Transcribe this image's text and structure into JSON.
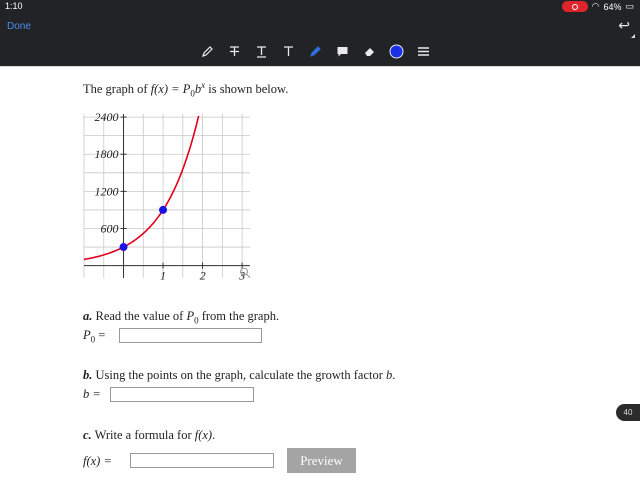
{
  "status_bar": {
    "time": "1:10",
    "battery": "64%"
  },
  "nav": {
    "done_label": "Done"
  },
  "toolbar": {
    "tools": [
      "pen-icon",
      "text-strike-icon",
      "text-underline-icon",
      "text-icon",
      "highlighter-icon",
      "comment-icon",
      "eraser-icon",
      "color-circle-icon",
      "menu-icon"
    ],
    "color": "#1c2fe8"
  },
  "problem": {
    "intro_prefix": "The graph of ",
    "intro_fx": "f(x) = P",
    "intro_sub": "0",
    "intro_b": "b",
    "intro_sup": "x",
    "intro_suffix": " is shown below.",
    "part_a_letter": "a.",
    "part_a_text": " Read the value of ",
    "part_a_var": "P",
    "part_a_sub": "0",
    "part_a_tail": " from the graph.",
    "part_a_label_var": "P",
    "part_a_label_sub": "0",
    "part_a_label_eq": " =",
    "part_b_letter": "b.",
    "part_b_text": " Using the points on the graph, calculate the growth factor ",
    "part_b_var": "b",
    "part_b_tail": ".",
    "part_b_label": "b =",
    "part_c_letter": "c.",
    "part_c_text": " Write a formula for ",
    "part_c_var": "f(x)",
    "part_c_tail": ".",
    "part_c_label": "f(x) =",
    "preview_label": "Preview",
    "input_a_value": "",
    "input_b_value": "",
    "input_c_value": ""
  },
  "page_badge": "40",
  "chart_data": {
    "type": "line",
    "x_ticks": [
      "1",
      "2",
      "3"
    ],
    "y_ticks": [
      "600",
      "1200",
      "1800",
      "2400"
    ],
    "xlim": [
      -1,
      3.2
    ],
    "ylim": [
      -200,
      2450
    ],
    "grid": true,
    "curve": {
      "P0": 300,
      "b": 3,
      "color": "#e0001b"
    },
    "points": [
      {
        "x": 0,
        "y": 300
      },
      {
        "x": 1,
        "y": 900
      }
    ],
    "point_color": "#1b12e6"
  }
}
